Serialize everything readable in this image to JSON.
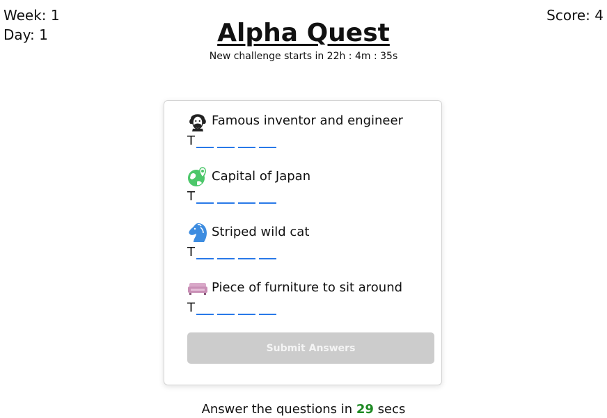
{
  "header": {
    "week_label": "Week: 1",
    "day_label": "Day: 1",
    "score_label": "Score: 4",
    "title": "Alpha Quest",
    "countdown": "New challenge starts in 22h : 4m : 35s"
  },
  "questions": [
    {
      "icon": "inventor-portrait-icon",
      "clue": "Famous inventor and engineer",
      "first_letter": "T",
      "blank_count": 4
    },
    {
      "icon": "globe-map-pin-icon",
      "clue": "Capital of Japan",
      "first_letter": "T",
      "blank_count": 4
    },
    {
      "icon": "horse-head-icon",
      "clue": "Striped wild cat",
      "first_letter": "T",
      "blank_count": 4
    },
    {
      "icon": "sofa-icon",
      "clue": "Piece of furniture to sit around",
      "first_letter": "T",
      "blank_count": 4
    }
  ],
  "submit_label": "Submit Answers",
  "footer": {
    "prefix": "Answer the questions in",
    "seconds": "29",
    "suffix": "secs"
  },
  "colors": {
    "blank_underline": "#2979e8",
    "timer_seconds": "#1f8a24",
    "submit_disabled_bg": "#cccccc"
  }
}
